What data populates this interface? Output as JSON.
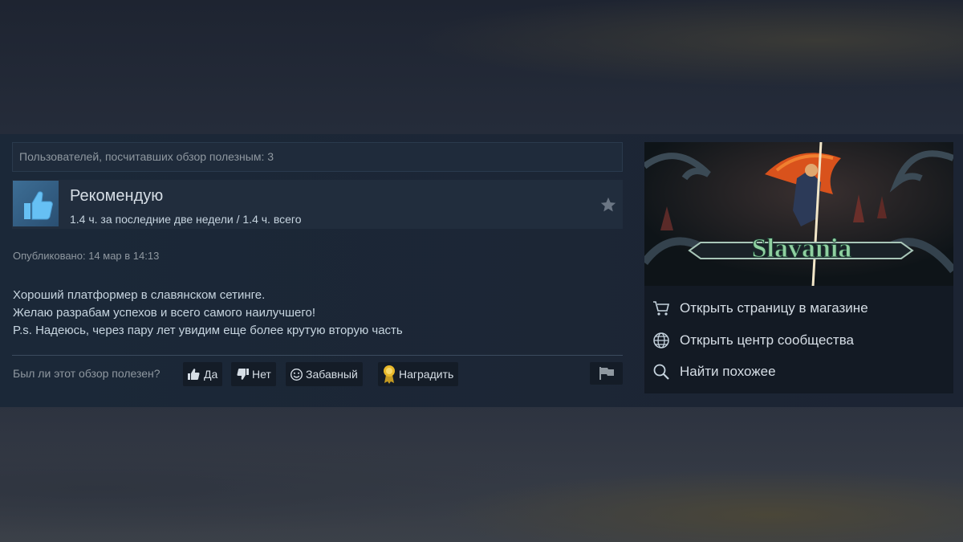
{
  "review": {
    "helpful_count_text": "Пользователей, посчитавших обзор полезным: 3",
    "recommendation": "Рекомендую",
    "hours_text": "1.4 ч. за последние две недели / 1.4 ч. всего",
    "posted_text": "Опубликовано: 14 мар в 14:13",
    "body_lines": [
      "Хороший платформер в славянском сетинге.",
      "Желаю разрабам успехов и всего самого наилучшего!",
      "P.s. Надеюсь, через пару лет увидим еще более крутую вторую часть"
    ]
  },
  "footer": {
    "question": "Был ли этот обзор полезен?",
    "yes_label": "Да",
    "no_label": "Нет",
    "funny_label": "Забавный",
    "award_label": "Наградить"
  },
  "game": {
    "logo_text": "Slavania",
    "links": [
      {
        "label": "Открыть страницу в магазине",
        "icon": "cart-icon"
      },
      {
        "label": "Открыть центр сообщества",
        "icon": "globe-icon"
      },
      {
        "label": "Найти похожее",
        "icon": "search-icon"
      }
    ]
  },
  "colors": {
    "panel_bg": "#1b2838",
    "accent_blue": "#3d6e95",
    "text_light": "#d6dee6",
    "text_muted": "#8f98a0",
    "award_gold": "#e8b82a"
  }
}
